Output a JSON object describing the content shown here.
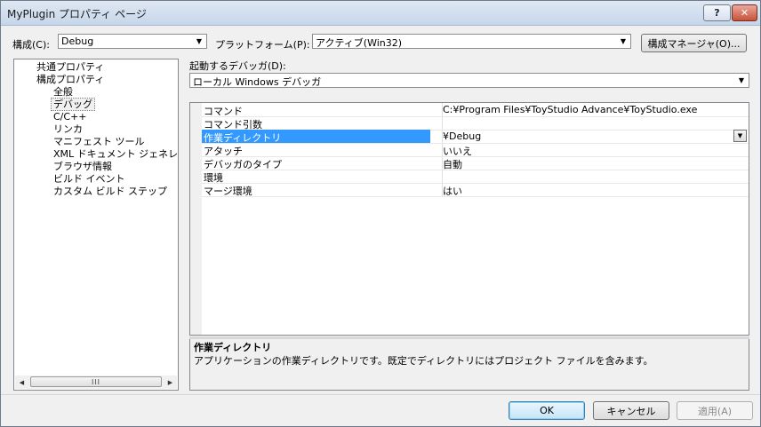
{
  "window": {
    "title": "MyPlugin プロパティ ページ",
    "help_label": "?",
    "close_label": "✕"
  },
  "config": {
    "label": "構成(C):",
    "value": "Debug",
    "platform_label": "プラットフォーム(P):",
    "platform_value": "アクティブ(Win32)",
    "manager_button": "構成マネージャ(O)..."
  },
  "tree": {
    "items": [
      {
        "label": "共通プロパティ"
      },
      {
        "label": "構成プロパティ"
      },
      {
        "label": "全般"
      },
      {
        "label": "デバッグ"
      },
      {
        "label": "C/C++"
      },
      {
        "label": "リンカ"
      },
      {
        "label": "マニフェスト ツール"
      },
      {
        "label": "XML ドキュメント ジェネレー"
      },
      {
        "label": "ブラウザ情報"
      },
      {
        "label": "ビルド イベント"
      },
      {
        "label": "カスタム ビルド ステップ"
      }
    ],
    "selected": "デバッグ",
    "scroll_grip": "III"
  },
  "debugger": {
    "label": "起動するデバッガ(D):",
    "value": "ローカル Windows デバッガ"
  },
  "properties": [
    {
      "name": "コマンド",
      "value": "C:¥Program Files¥ToyStudio Advance¥ToyStudio.exe"
    },
    {
      "name": "コマンド引数",
      "value": ""
    },
    {
      "name": "作業ディレクトリ",
      "value": "¥Debug"
    },
    {
      "name": "アタッチ",
      "value": "いいえ"
    },
    {
      "name": "デバッガのタイプ",
      "value": "自動"
    },
    {
      "name": "環境",
      "value": ""
    },
    {
      "name": "マージ環境",
      "value": "はい"
    }
  ],
  "selected_property": "作業ディレクトリ",
  "description": {
    "title": "作業ディレクトリ",
    "text": "アプリケーションの作業ディレクトリです。既定でディレクトリにはプロジェクト ファイルを含みます。"
  },
  "buttons": {
    "ok": "OK",
    "cancel": "キャンセル",
    "apply": "適用(A)"
  },
  "colors": {
    "selection": "#3399ff",
    "window_bg": "#f0f0f0"
  }
}
